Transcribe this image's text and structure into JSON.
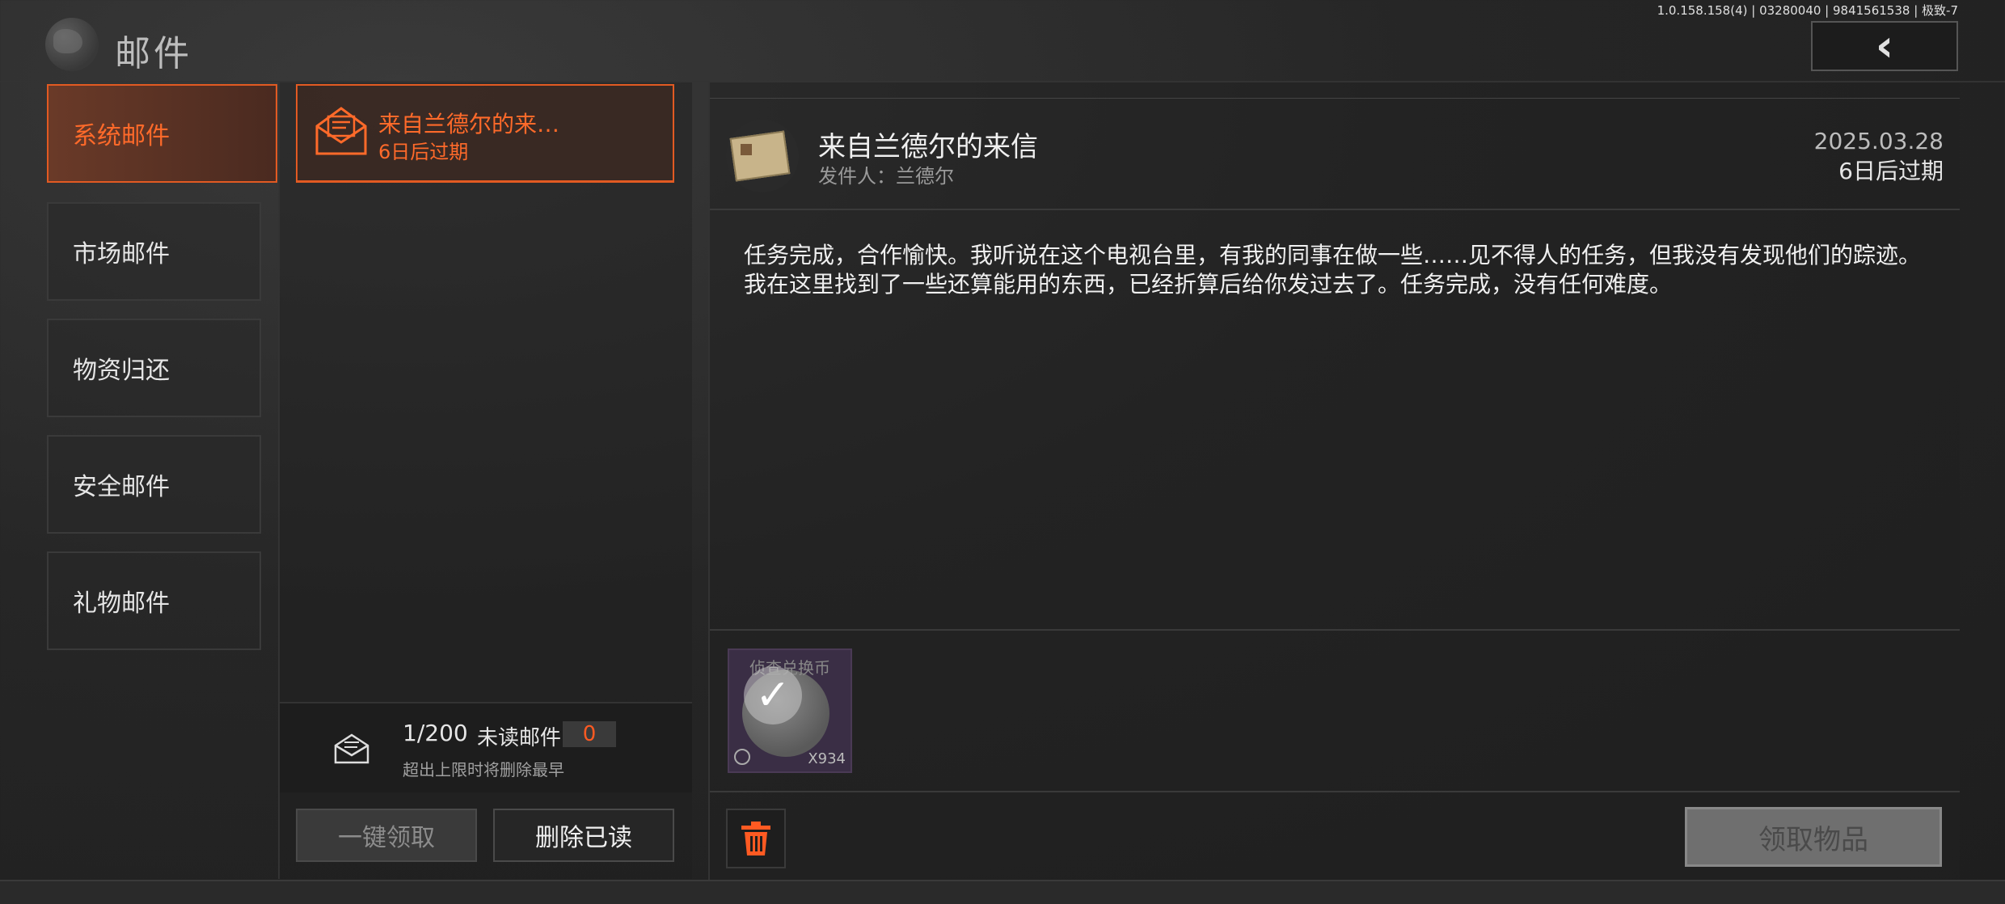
{
  "header": {
    "title": "邮件",
    "version": "1.0.158.158(4) | 03280040 | 9841561538 | 极致-7",
    "back_icon": "chevron-left-icon"
  },
  "sidebar": {
    "items": [
      {
        "label": "系统邮件",
        "active": true
      },
      {
        "label": "市场邮件",
        "active": false
      },
      {
        "label": "物资归还",
        "active": false
      },
      {
        "label": "安全邮件",
        "active": false
      },
      {
        "label": "礼物邮件",
        "active": false
      }
    ]
  },
  "mail_list": {
    "items": [
      {
        "title": "来自兰德尔的来…",
        "expire": "6日后过期",
        "icon": "envelope-icon"
      }
    ]
  },
  "mail_count": {
    "count": "1/200",
    "unread_label": "未读邮件",
    "unread_value": "0",
    "note": "超出上限时将删除最早"
  },
  "actions": {
    "claim_all": "一键领取",
    "delete_read": "删除已读"
  },
  "detail": {
    "title": "来自兰德尔的来信",
    "sender": "发件人：兰德尔",
    "date": "2025.03.28",
    "expire": "6日后过期",
    "body": "任务完成，合作愉快。我听说在这个电视台里，有我的同事在做一些……见不得人的任务，但我没有发现他们的踪迹。我在这里找到了一些还算能用的东西，已经折算后给你发过去了。任务完成，没有任何难度。",
    "attachment": {
      "name": "侦查兑换币",
      "quantity": "X934",
      "claimed": true
    },
    "claim_button": "领取物品",
    "trash_icon": "trash-icon"
  },
  "colors": {
    "accent": "#e25a22",
    "background": "#242424"
  }
}
